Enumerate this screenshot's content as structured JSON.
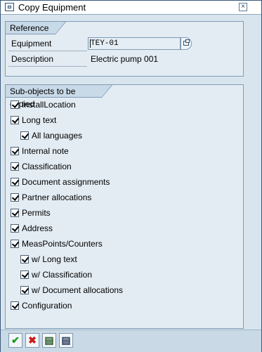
{
  "window": {
    "title": "Copy Equipment",
    "close_symbol": "×"
  },
  "reference": {
    "title": "Reference",
    "equipment_label": "Equipment",
    "equipment_value": "TEY-01",
    "description_label": "Description",
    "description_value": "Electric pump 001"
  },
  "subobjects": {
    "title": "Sub-objects to be copied",
    "items": [
      {
        "label": "InstallLocation",
        "checked": true,
        "indent": 0
      },
      {
        "label": "Long text",
        "checked": true,
        "indent": 0
      },
      {
        "label": "All languages",
        "checked": true,
        "indent": 1
      },
      {
        "label": "Internal note",
        "checked": true,
        "indent": 0
      },
      {
        "label": "Classification",
        "checked": true,
        "indent": 0
      },
      {
        "label": "Document assignments",
        "checked": true,
        "indent": 0
      },
      {
        "label": "Partner allocations",
        "checked": true,
        "indent": 0
      },
      {
        "label": "Permits",
        "checked": true,
        "indent": 0
      },
      {
        "label": "Address",
        "checked": true,
        "indent": 0
      },
      {
        "label": "MeasPoints/Counters",
        "checked": true,
        "indent": 0
      },
      {
        "label": "w/ Long text",
        "checked": true,
        "indent": 1
      },
      {
        "label": "w/ Classification",
        "checked": true,
        "indent": 1
      },
      {
        "label": "w/ Document allocations",
        "checked": true,
        "indent": 1
      },
      {
        "label": "Configuration",
        "checked": true,
        "indent": 0
      }
    ]
  },
  "toolbar": {
    "buttons": [
      {
        "name": "continue-button",
        "icon": "checkmark-icon",
        "glyph": "✔",
        "color": "#1a9a1a"
      },
      {
        "name": "cancel-button",
        "icon": "cross-icon",
        "glyph": "✖",
        "color": "#cc1a1a"
      },
      {
        "name": "select-all-button",
        "icon": "select-all-icon",
        "glyph": "▤",
        "color": "#2a5a2a"
      },
      {
        "name": "deselect-all-button",
        "icon": "deselect-all-icon",
        "glyph": "▤",
        "color": "#2a3a5a"
      }
    ]
  }
}
